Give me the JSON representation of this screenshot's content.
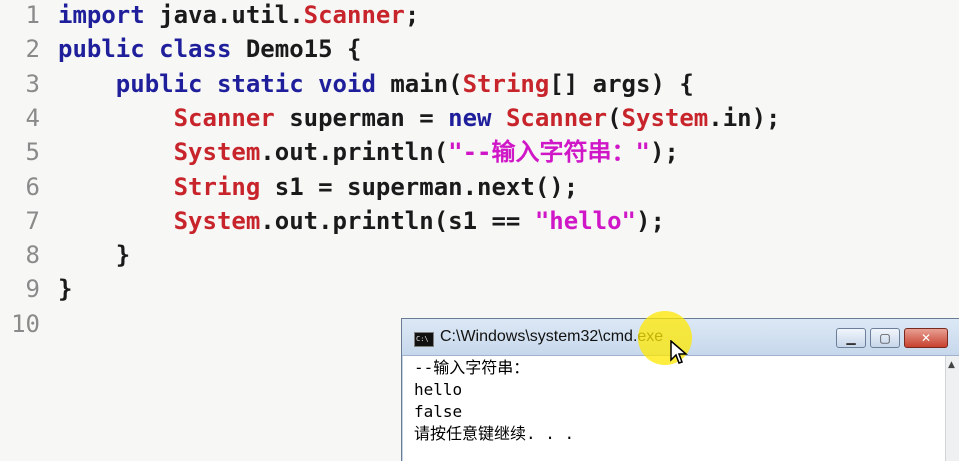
{
  "editor": {
    "lines": [
      {
        "num": "1",
        "parts": [
          {
            "t": "import ",
            "c": "kw"
          },
          {
            "t": "java.util.",
            "c": "plain"
          },
          {
            "t": "Scanner",
            "c": "cls"
          },
          {
            "t": ";",
            "c": "plain"
          }
        ]
      },
      {
        "num": "2",
        "parts": [
          {
            "t": "public ",
            "c": "kw"
          },
          {
            "t": "class ",
            "c": "kw"
          },
          {
            "t": "Demo15 {",
            "c": "plain"
          }
        ]
      },
      {
        "num": "3",
        "parts": [
          {
            "t": "    public ",
            "c": "kw"
          },
          {
            "t": "static ",
            "c": "kw"
          },
          {
            "t": "void ",
            "c": "kw"
          },
          {
            "t": "main(",
            "c": "plain"
          },
          {
            "t": "String",
            "c": "cls"
          },
          {
            "t": "[] args) {",
            "c": "plain"
          }
        ]
      },
      {
        "num": "4",
        "parts": [
          {
            "t": "        ",
            "c": "plain"
          },
          {
            "t": "Scanner",
            "c": "cls"
          },
          {
            "t": " superman = ",
            "c": "plain"
          },
          {
            "t": "new ",
            "c": "kw"
          },
          {
            "t": "Scanner",
            "c": "cls"
          },
          {
            "t": "(",
            "c": "plain"
          },
          {
            "t": "System",
            "c": "cls"
          },
          {
            "t": ".in);",
            "c": "plain"
          }
        ]
      },
      {
        "num": "5",
        "parts": [
          {
            "t": "        ",
            "c": "plain"
          },
          {
            "t": "System",
            "c": "cls"
          },
          {
            "t": ".out.println(",
            "c": "plain"
          },
          {
            "t": "\"--输入字符串：\"",
            "c": "str"
          },
          {
            "t": ");",
            "c": "plain"
          }
        ]
      },
      {
        "num": "6",
        "parts": [
          {
            "t": "        ",
            "c": "plain"
          },
          {
            "t": "String",
            "c": "cls"
          },
          {
            "t": " s1 = superman.next();",
            "c": "plain"
          }
        ]
      },
      {
        "num": "7",
        "parts": [
          {
            "t": "        ",
            "c": "plain"
          },
          {
            "t": "System",
            "c": "cls"
          },
          {
            "t": ".out.println(s1 == ",
            "c": "plain"
          },
          {
            "t": "\"hello\"",
            "c": "str"
          },
          {
            "t": ");",
            "c": "plain"
          }
        ]
      },
      {
        "num": "8",
        "parts": [
          {
            "t": "    }",
            "c": "plain"
          }
        ]
      },
      {
        "num": "9",
        "parts": [
          {
            "t": "}",
            "c": "plain"
          }
        ]
      },
      {
        "num": "10",
        "parts": []
      }
    ]
  },
  "cmd_window": {
    "title": "C:\\Windows\\system32\\cmd.exe",
    "icon_label": "C:\\",
    "icons": {
      "min": "minimize-icon",
      "max": "maximize-icon",
      "close": "close-icon"
    },
    "min_glyph": "▁",
    "max_glyph": "▢",
    "close_glyph": "✕",
    "output": [
      "--输入字符串：",
      "hello",
      "false",
      "请按任意键继续. . ."
    ],
    "scroll_up_glyph": "▲"
  },
  "colors": {
    "keyword": "#1f1f9c",
    "class_name": "#c8242b",
    "string": "#d017c8",
    "line_number": "#8a8a8a"
  }
}
